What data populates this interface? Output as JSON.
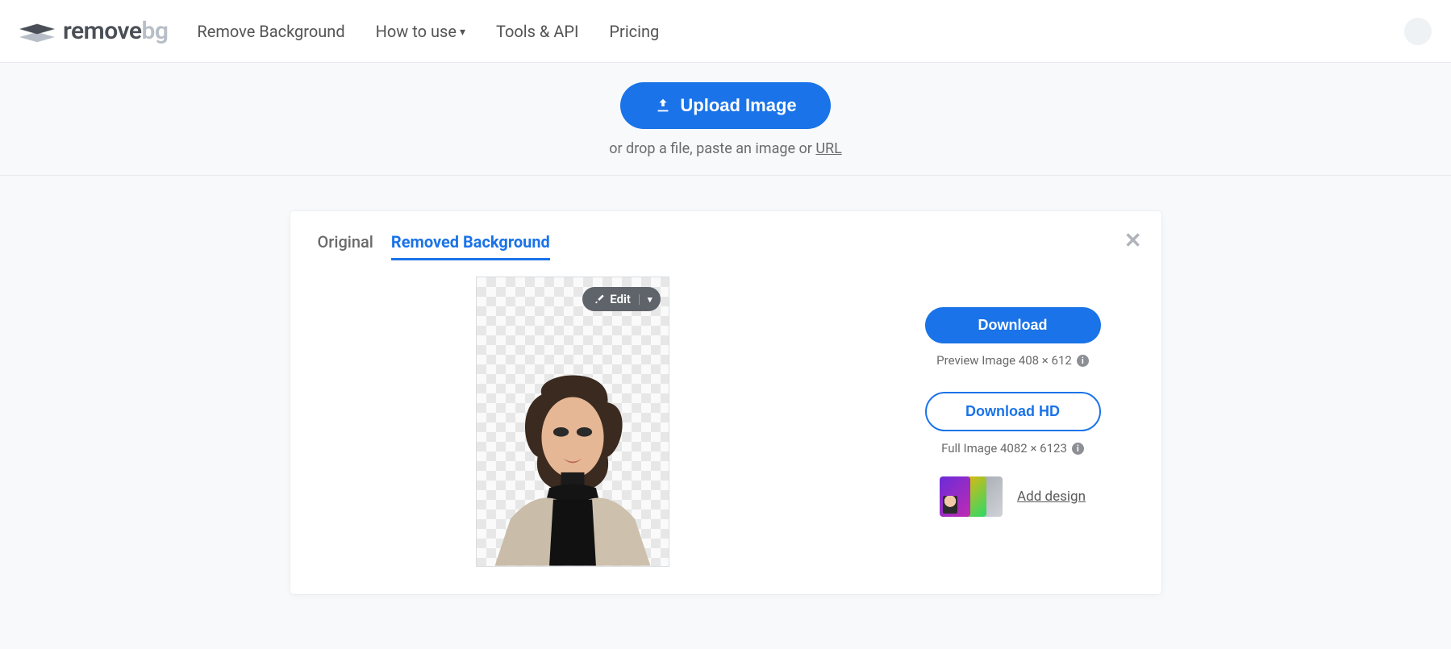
{
  "brand": {
    "part1": "remove",
    "part2": "bg"
  },
  "nav": {
    "remove_bg": "Remove Background",
    "how_to_use": "How to use",
    "tools_api": "Tools & API",
    "pricing": "Pricing"
  },
  "upload": {
    "button": "Upload Image",
    "hint_prefix": "or drop a file, paste an image or ",
    "url_label": "URL"
  },
  "card": {
    "tabs": {
      "original": "Original",
      "removed": "Removed Background"
    },
    "edit_label": "Edit",
    "download": {
      "preview_btn": "Download",
      "preview_hint": "Preview Image 408 × 612",
      "hd_btn": "Download HD",
      "hd_hint": "Full Image 4082 × 6123"
    },
    "add_design": "Add design"
  },
  "colors": {
    "accent": "#1a73e8"
  }
}
